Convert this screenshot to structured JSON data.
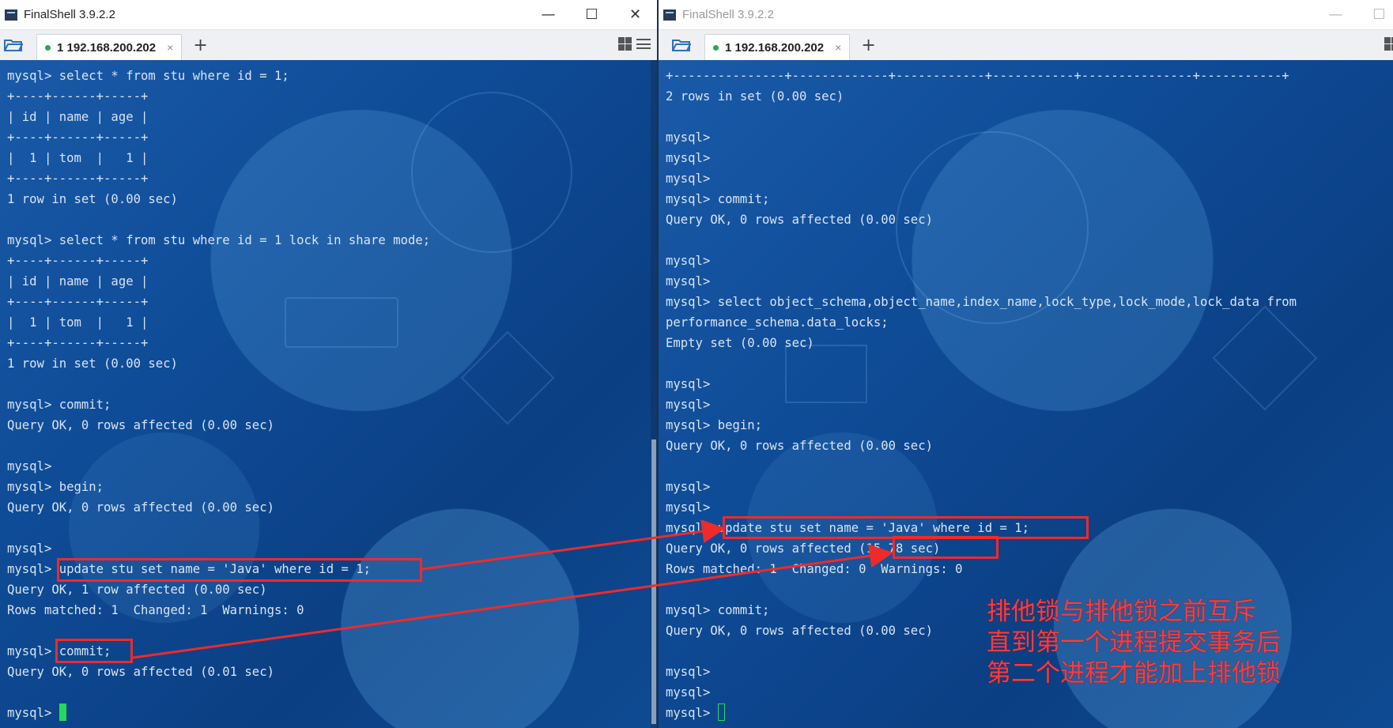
{
  "left_window": {
    "title": "FinalShell 3.9.2.2",
    "controls": {
      "minimize": "—",
      "maximize": "☐",
      "close": "✕"
    },
    "tab": {
      "label": "1 192.168.200.202",
      "close": "×"
    },
    "add_tab": "+",
    "terminal_lines": [
      "mysql> select * from stu where id = 1;",
      "+----+------+-----+",
      "| id | name | age |",
      "+----+------+-----+",
      "|  1 | tom  |   1 |",
      "+----+------+-----+",
      "1 row in set (0.00 sec)",
      "",
      "mysql> select * from stu where id = 1 lock in share mode;",
      "+----+------+-----+",
      "| id | name | age |",
      "+----+------+-----+",
      "|  1 | tom  |   1 |",
      "+----+------+-----+",
      "1 row in set (0.00 sec)",
      "",
      "mysql> commit;",
      "Query OK, 0 rows affected (0.00 sec)",
      "",
      "mysql>",
      "mysql> begin;",
      "Query OK, 0 rows affected (0.00 sec)",
      "",
      "mysql>",
      "mysql> update stu set name = 'Java' where id = 1;",
      "Query OK, 1 row affected (0.00 sec)",
      "Rows matched: 1  Changed: 1  Warnings: 0",
      "",
      "mysql> commit;",
      "Query OK, 0 rows affected (0.01 sec)",
      "",
      "mysql> "
    ]
  },
  "right_window": {
    "title": "FinalShell 3.9.2.2",
    "controls": {
      "minimize": "—",
      "maximize": "☐"
    },
    "tab": {
      "label": "1 192.168.200.202",
      "close": "×"
    },
    "add_tab": "+",
    "terminal_lines": [
      "+---------------+-------------+------------+-----------+---------------+-----------+",
      "2 rows in set (0.00 sec)",
      "",
      "mysql>",
      "mysql>",
      "mysql>",
      "mysql> commit;",
      "Query OK, 0 rows affected (0.00 sec)",
      "",
      "mysql>",
      "mysql>",
      "mysql> select object_schema,object_name,index_name,lock_type,lock_mode,lock_data from",
      "performance_schema.data_locks;",
      "Empty set (0.00 sec)",
      "",
      "mysql>",
      "mysql>",
      "mysql> begin;",
      "Query OK, 0 rows affected (0.00 sec)",
      "",
      "mysql>",
      "mysql>",
      "mysql> update stu set name = 'Java' where id = 1;",
      "Query OK, 0 rows affected (15.78 sec)",
      "Rows matched: 1  Changed: 0  Warnings: 0",
      "",
      "mysql> commit;",
      "Query OK, 0 rows affected (0.00 sec)",
      "",
      "mysql>",
      "mysql>",
      "mysql> "
    ]
  },
  "annotation": {
    "lines": [
      "排他锁与排他锁之前互斥",
      "直到第一个进程提交事务后",
      "第二个进程才能加上排他锁"
    ],
    "color": "#ff3b3b"
  },
  "colors": {
    "terminal_text": "#d8e4f2",
    "highlight_border": "#ef2a2a",
    "cursor": "#25d85a",
    "connected_dot": "#2aa84a"
  }
}
